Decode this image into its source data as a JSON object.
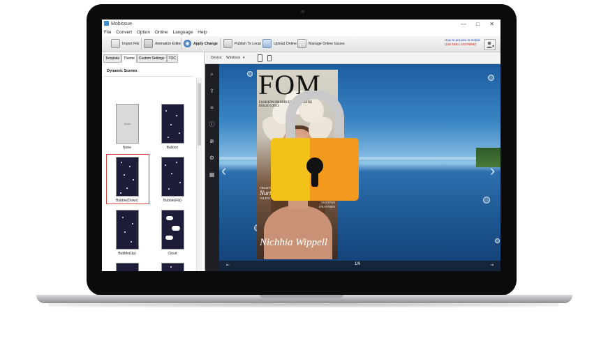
{
  "window": {
    "title": "Mobissue",
    "controls": "— □ ✕"
  },
  "menu": [
    "File",
    "Convert",
    "Option",
    "Online",
    "Language",
    "Help"
  ],
  "toolbar": {
    "import_label": "Import File",
    "animation_label": "Animation Editor",
    "apply_label": "Apply Change",
    "publish_label": "Publish To Local",
    "upload_label": "Upload Online",
    "manage_label": "Manage Online Issues",
    "mobile_note": "How to preview in mobile",
    "ip": "(192.168.1.102:9094/)"
  },
  "left": {
    "tabs": [
      "Template",
      "Theme",
      "Custom Settings",
      "TOC"
    ],
    "active_tab": "Theme",
    "section_title": "Dynamic Scenes",
    "scenes": [
      {
        "label": "None",
        "selected": false
      },
      {
        "label": "Balloon",
        "selected": false
      },
      {
        "label": "Bubble(Down)",
        "selected": true
      },
      {
        "label": "Bubble(Flb)",
        "selected": false
      },
      {
        "label": "Bubble(Up)",
        "selected": false
      },
      {
        "label": "Cloud",
        "selected": false
      },
      {
        "label": "",
        "selected": false
      },
      {
        "label": "",
        "selected": false
      }
    ],
    "none_thumb_text": "None"
  },
  "viewer": {
    "device_label": "Device:",
    "device_value": "Windows",
    "page_indicator": "1/6"
  },
  "magazine": {
    "title": "FOM",
    "subtitle": "FASHION OBSERVER MAGAZINE",
    "issue": "ISSUE 6 2013",
    "left_small": "CREATIVE",
    "left_big": "Nurture",
    "left_tail": "TALENT",
    "right_lines": [
      "GET THE LOOK",
      "RAW BRISBANE",
      "ESCAPE TO EUROPE",
      "EMERGING DESIGNER",
      "CREATIVES UNCOVERED"
    ],
    "signature": "Nichhia Wippell"
  },
  "colors": {
    "lock_left": "#F2C21B",
    "lock_right": "#F39A1E",
    "shackle": "#C9C9C9",
    "keyhole": "#111111",
    "selection_border": "#D04444",
    "link_blue": "#1D3FBF",
    "ip_red": "#DD1111"
  },
  "icons": {
    "sidebar": [
      "search-icon",
      "share-icon",
      "menu-icon",
      "info-icon",
      "zoom-in-icon",
      "cog-icon",
      "grid-icon"
    ]
  }
}
